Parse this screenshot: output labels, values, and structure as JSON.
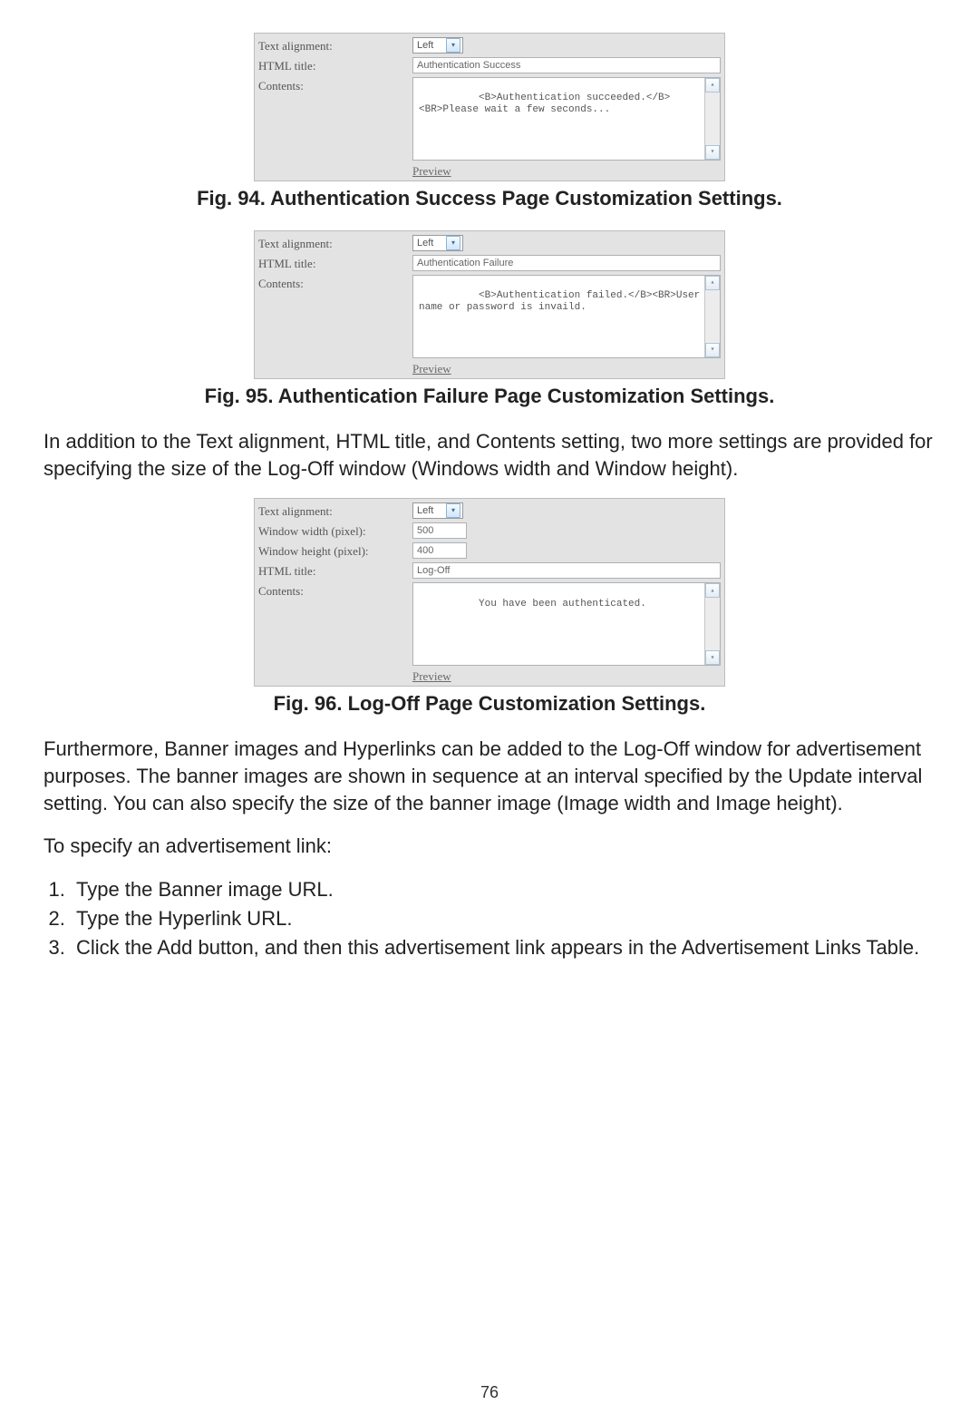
{
  "fig1": {
    "rows": {
      "text_alignment_label": "Text alignment:",
      "text_alignment_value": "Left",
      "html_title_label": "HTML title:",
      "html_title_value": "Authentication Success",
      "contents_label": "Contents:",
      "contents_value": "<B>Authentication succeeded.</B><BR>Please wait a few seconds..."
    },
    "preview_label": "Preview",
    "caption": "Fig. 94. Authentication Success Page Customization Settings."
  },
  "fig2": {
    "rows": {
      "text_alignment_label": "Text alignment:",
      "text_alignment_value": "Left",
      "html_title_label": "HTML title:",
      "html_title_value": "Authentication Failure",
      "contents_label": "Contents:",
      "contents_value": "<B>Authentication failed.</B><BR>User name or password is invaild."
    },
    "preview_label": "Preview",
    "caption": "Fig. 95. Authentication Failure Page Customization Settings."
  },
  "para1": "In addition to the Text alignment, HTML title, and Contents setting, two more settings are provided for specifying the size of the Log-Off window (Windows width and Window height).",
  "fig3": {
    "rows": {
      "text_alignment_label": "Text alignment:",
      "text_alignment_value": "Left",
      "window_width_label": "Window width (pixel):",
      "window_width_value": "500",
      "window_height_label": "Window height (pixel):",
      "window_height_value": "400",
      "html_title_label": "HTML title:",
      "html_title_value": "Log-Off",
      "contents_label": "Contents:",
      "contents_value": "You have been authenticated."
    },
    "preview_label": "Preview",
    "caption": "Fig. 96. Log-Off Page Customization Settings."
  },
  "para2": "Furthermore, Banner images and Hyperlinks can be added to the Log-Off window for advertisement purposes. The banner images are shown in sequence at an interval specified by the Update interval setting. You can also specify the size of the banner image (Image width and Image height).",
  "para3": "To specify an advertisement link:",
  "steps": [
    "Type the Banner image URL.",
    "Type the Hyperlink URL.",
    "Click the Add button, and then this advertisement link appears in the Advertisement Links Table."
  ],
  "page_number": "76"
}
